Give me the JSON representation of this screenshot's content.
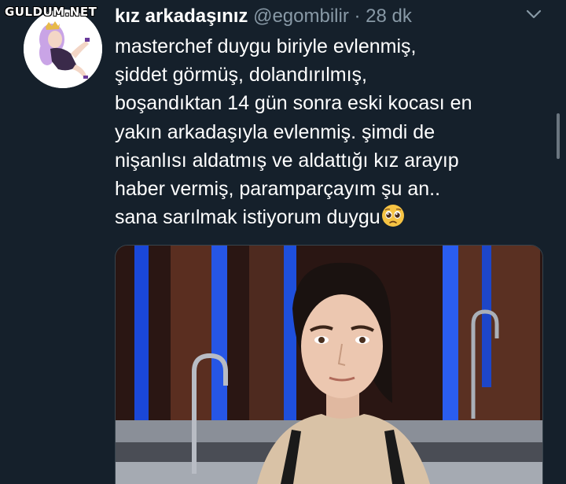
{
  "watermark": {
    "text": "GULDUM.NET"
  },
  "tweet": {
    "display_name": "kız arkadaşınız",
    "handle": "@egombilir",
    "separator": "·",
    "time": "28 dk",
    "text": "masterchef duygu biriyle evlenmiş,\nşiddet görmüş, dolandırılmış,\nboşandıktan 14 gün sonra eski kocası en\nyakın arkadaşıyla evlenmiş. şimdi de\nnişanlısı aldatmış ve aldattığı kız arayıp\nhaber vermiş, paramparçayım şu an..\nsana sarılmak istiyorum duygu",
    "emoji": "pleading-face-emoji"
  },
  "icons": {
    "more": "chevron-down-icon",
    "avatar": "avatar-illustration"
  },
  "colors": {
    "background": "#15202b",
    "secondary_text": "#8899a6",
    "primary_text": "#ffffff",
    "border": "#38444d"
  }
}
